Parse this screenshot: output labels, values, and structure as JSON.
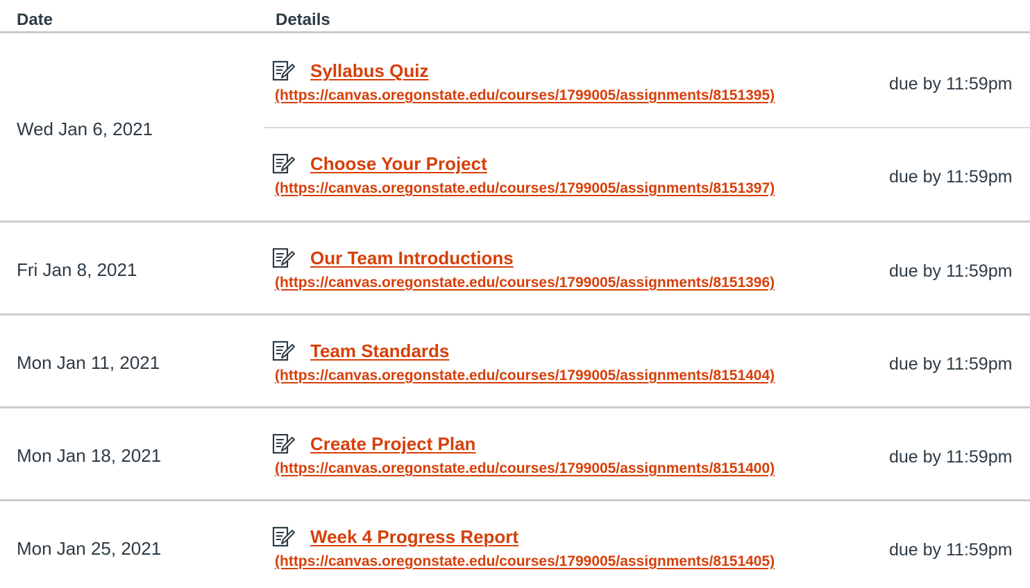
{
  "table": {
    "headers": {
      "date": "Date",
      "details": "Details"
    },
    "icon": "assignment-icon",
    "accent_color": "#d73f09",
    "groups": [
      {
        "date": "Wed Jan 6, 2021",
        "items": [
          {
            "title": "Syllabus Quiz",
            "url": "(https://canvas.oregonstate.edu/courses/1799005/assignments/8151395)",
            "due": "due by 11:59pm"
          },
          {
            "title": "Choose Your Project",
            "url": "(https://canvas.oregonstate.edu/courses/1799005/assignments/8151397)",
            "due": "due by 11:59pm"
          }
        ]
      },
      {
        "date": "Fri Jan 8, 2021",
        "items": [
          {
            "title": "Our Team Introductions",
            "url": "(https://canvas.oregonstate.edu/courses/1799005/assignments/8151396)",
            "due": "due by 11:59pm"
          }
        ]
      },
      {
        "date": "Mon Jan 11, 2021",
        "items": [
          {
            "title": "Team Standards",
            "url": "(https://canvas.oregonstate.edu/courses/1799005/assignments/8151404)",
            "due": "due by 11:59pm"
          }
        ]
      },
      {
        "date": "Mon Jan 18, 2021",
        "items": [
          {
            "title": "Create Project Plan",
            "url": "(https://canvas.oregonstate.edu/courses/1799005/assignments/8151400)",
            "due": "due by 11:59pm"
          }
        ]
      },
      {
        "date": "Mon Jan 25, 2021",
        "items": [
          {
            "title": "Week 4 Progress Report",
            "url": "(https://canvas.oregonstate.edu/courses/1799005/assignments/8151405)",
            "due": "due by 11:59pm"
          }
        ]
      }
    ]
  }
}
